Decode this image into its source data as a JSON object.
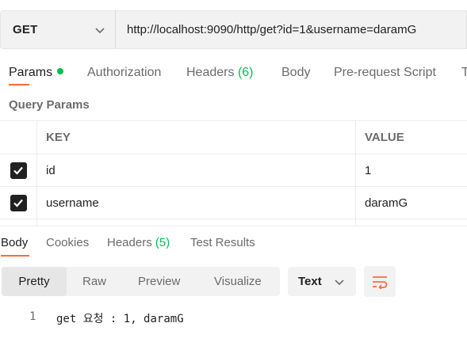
{
  "request": {
    "method": "GET",
    "url": "http://localhost:9090/http/get?id=1&username=daramG"
  },
  "request_tabs": {
    "params": "Params",
    "authorization": "Authorization",
    "headers": "Headers",
    "headers_count": "(6)",
    "body": "Body",
    "pre_request": "Pre-request Script",
    "tests_partial": "T"
  },
  "query_params": {
    "title": "Query Params",
    "key_header": "KEY",
    "value_header": "VALUE",
    "rows": [
      {
        "checked": true,
        "key": "id",
        "value": "1"
      },
      {
        "checked": true,
        "key": "username",
        "value": "daramG"
      }
    ]
  },
  "response_tabs": {
    "body": "Body",
    "cookies": "Cookies",
    "headers": "Headers",
    "headers_count": "(5)",
    "test_results": "Test Results"
  },
  "format": {
    "pretty": "Pretty",
    "raw": "Raw",
    "preview": "Preview",
    "visualize": "Visualize",
    "language": "Text"
  },
  "response_body": {
    "line_number": "1",
    "line_text": "get 요청 : 1, daramG"
  },
  "colors": {
    "accent": "#ff6c37",
    "success": "#0cbb52"
  }
}
